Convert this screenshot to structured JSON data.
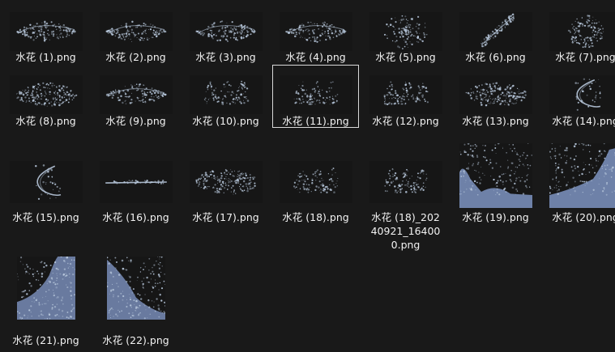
{
  "files": [
    {
      "name": "水花 (1).png",
      "icon": "splash-thumbnail"
    },
    {
      "name": "水花 (2).png",
      "icon": "splash-thumbnail"
    },
    {
      "name": "水花 (3).png",
      "icon": "splash-thumbnail"
    },
    {
      "name": "水花 (4).png",
      "icon": "splash-thumbnail"
    },
    {
      "name": "水花 (5).png",
      "icon": "splash-thumbnail"
    },
    {
      "name": "水花 (6).png",
      "icon": "splash-thumbnail"
    },
    {
      "name": "水花 (7).png",
      "icon": "splash-thumbnail"
    },
    {
      "name": "水花 (8).png",
      "icon": "splash-thumbnail"
    },
    {
      "name": "水花 (9).png",
      "icon": "splash-thumbnail"
    },
    {
      "name": "水花 (10).png",
      "icon": "splash-thumbnail"
    },
    {
      "name": "水花 (11).png",
      "icon": "splash-thumbnail",
      "selected": true
    },
    {
      "name": "水花 (12).png",
      "icon": "splash-thumbnail"
    },
    {
      "name": "水花 (13).png",
      "icon": "splash-thumbnail"
    },
    {
      "name": "水花 (14).png",
      "icon": "splash-thumbnail"
    },
    {
      "name": "水花 (15).png",
      "icon": "splash-thumbnail"
    },
    {
      "name": "水花 (16).png",
      "icon": "splash-thumbnail"
    },
    {
      "name": "水花 (17).png",
      "icon": "splash-thumbnail"
    },
    {
      "name": "水花 (18).png",
      "icon": "splash-thumbnail"
    },
    {
      "name": "水花 (18)_20240921_164000.png",
      "icon": "splash-thumbnail"
    },
    {
      "name": "水花 (19).png",
      "icon": "splash-thumbnail"
    },
    {
      "name": "水花 (20).png",
      "icon": "splash-thumbnail"
    },
    {
      "name": "水花 (21).png",
      "icon": "splash-thumbnail"
    },
    {
      "name": "水花 (22).png",
      "icon": "splash-thumbnail"
    }
  ],
  "colors": {
    "background": "#191919",
    "selection_border": "#d9d9d9",
    "splash": "#b8c8dc",
    "water_fill": "#7e94c2"
  }
}
